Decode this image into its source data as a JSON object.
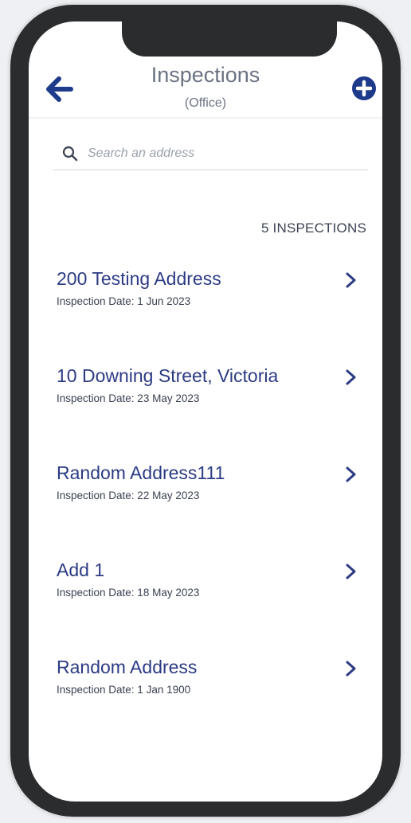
{
  "header": {
    "title": "Inspections",
    "subtitle": "(Office)",
    "back_icon": "arrow-left-icon",
    "add_icon": "plus-circle-icon"
  },
  "search": {
    "placeholder": "Search an address",
    "value": "",
    "icon": "search-icon"
  },
  "count_label": "5 INSPECTIONS",
  "inspections": [
    {
      "address": "200 Testing Address",
      "date": "Inspection Date: 1 Jun 2023"
    },
    {
      "address": "10 Downing Street, Victoria",
      "date": "Inspection Date: 23 May 2023"
    },
    {
      "address": "Random Address111",
      "date": "Inspection Date: 22 May 2023"
    },
    {
      "address": "Add 1",
      "date": "Inspection Date: 18 May 2023"
    },
    {
      "address": "Random Address",
      "date": "Inspection Date: 1 Jan 1900"
    }
  ],
  "colors": {
    "accent": "#1e3a8a",
    "title_text": "#6b7383",
    "item_title": "#2c3b84",
    "frame": "#2a2c2e"
  }
}
